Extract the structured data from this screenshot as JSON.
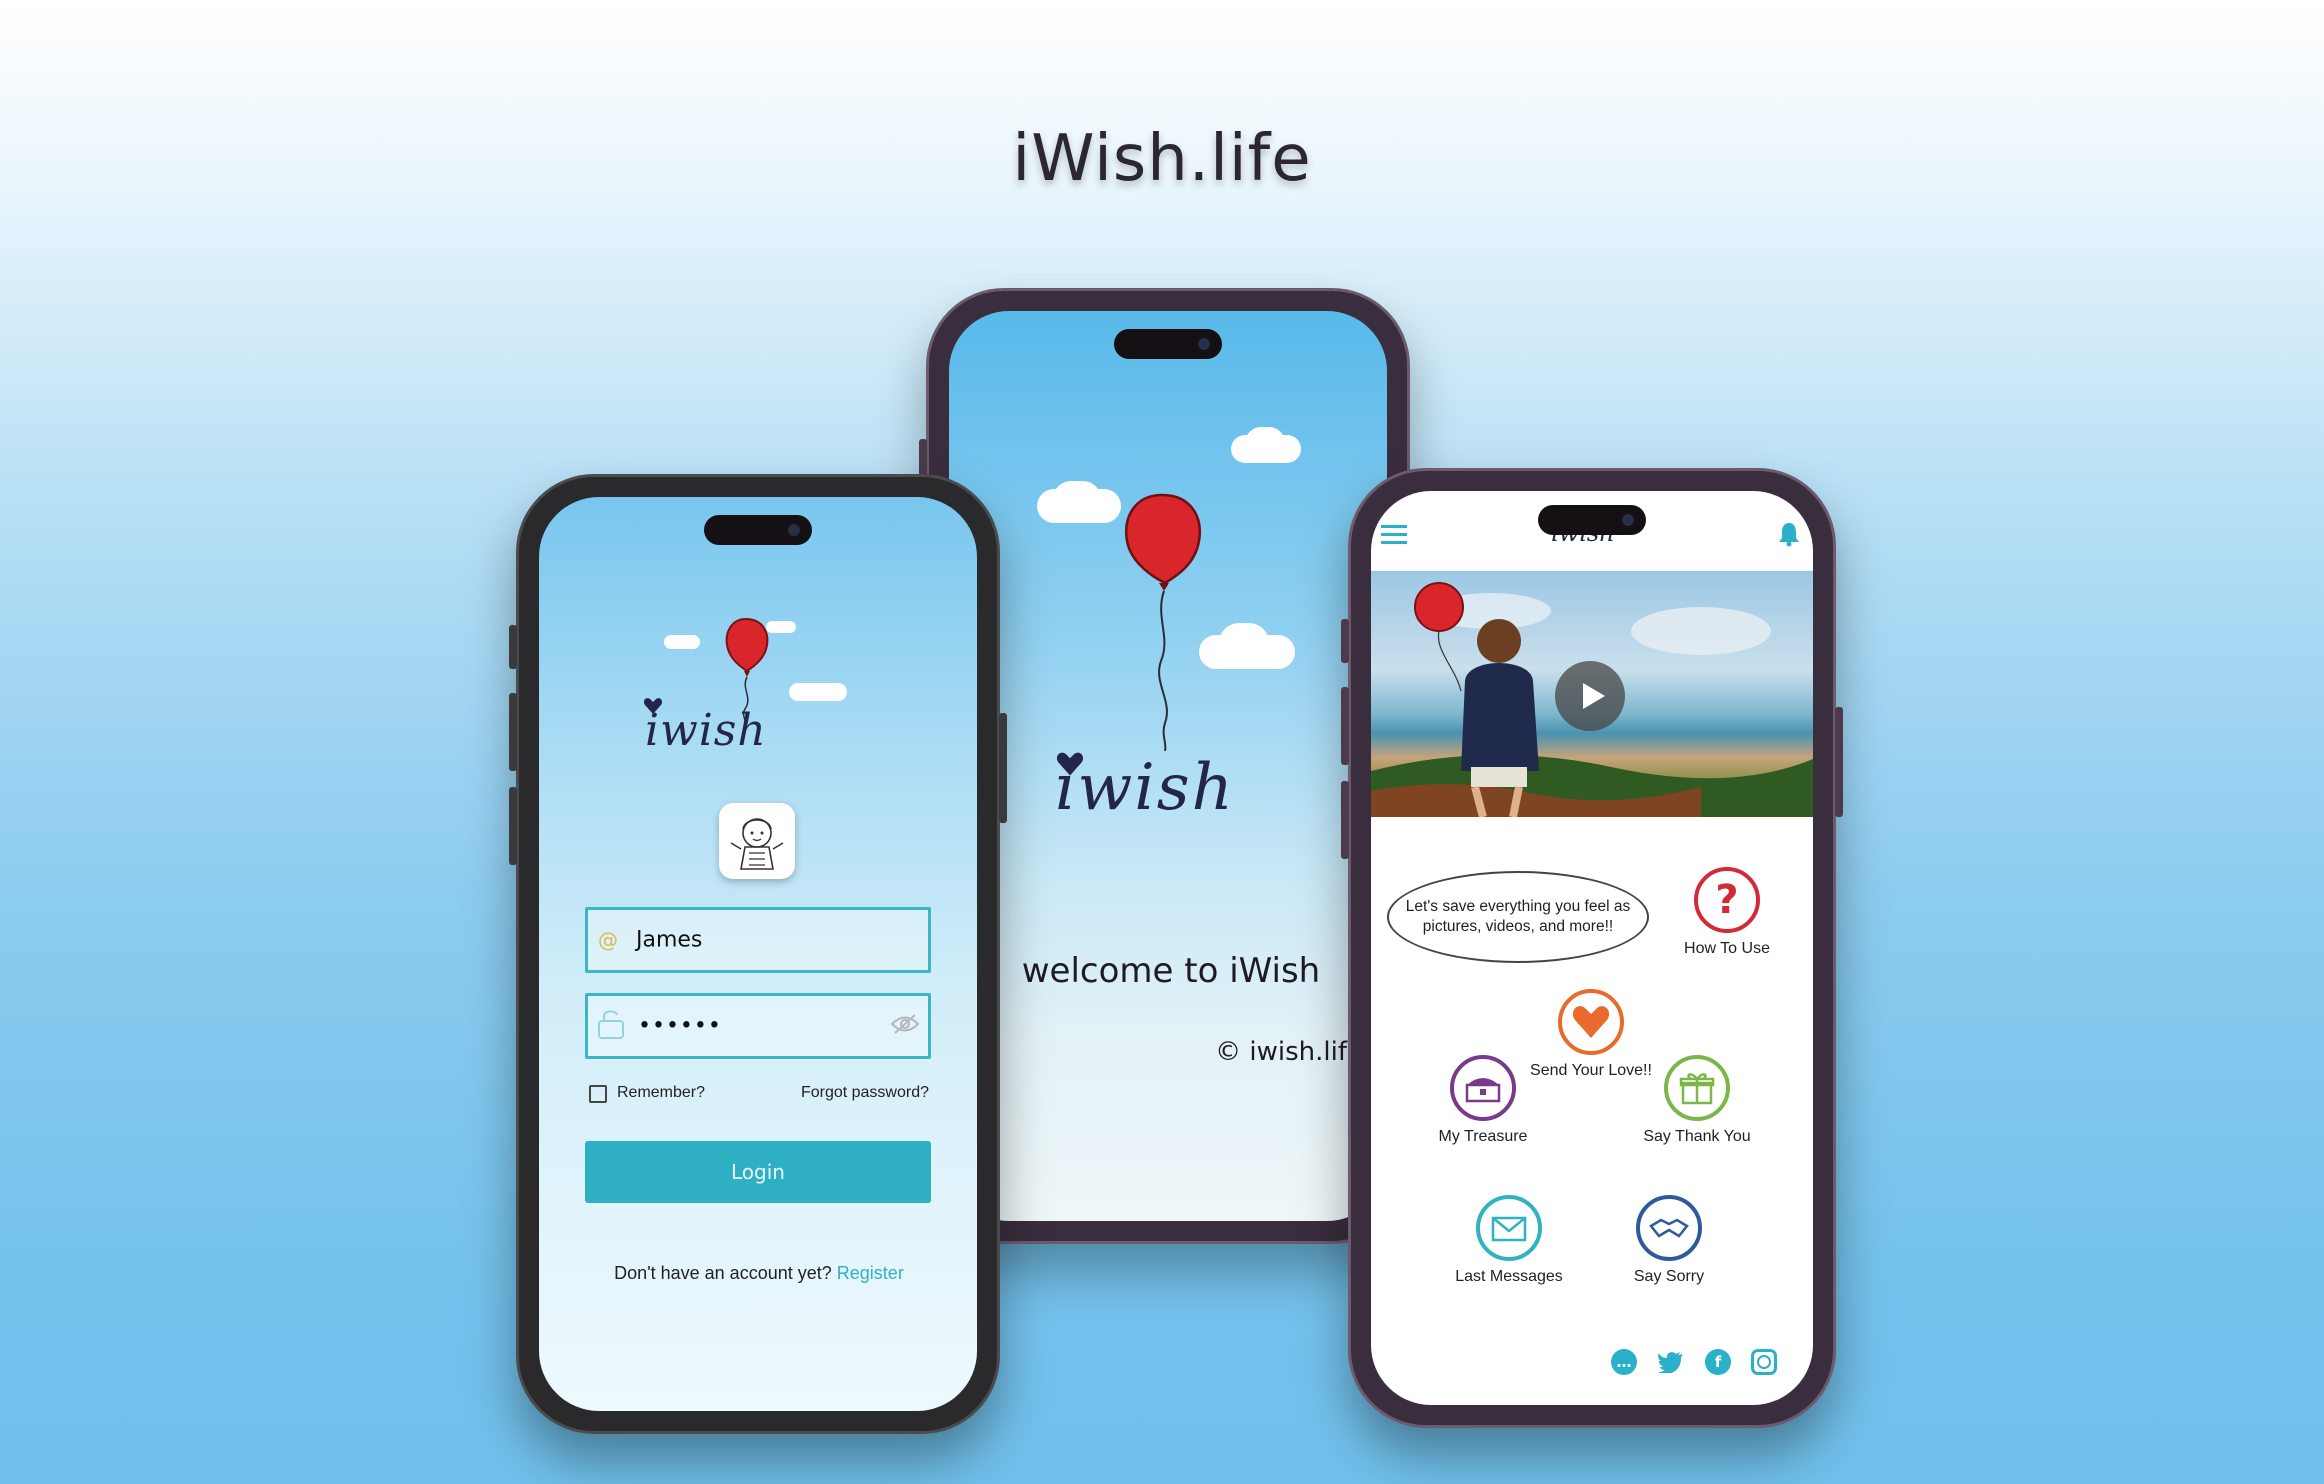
{
  "headline": "iWish.life",
  "login_screen": {
    "logo_text": "iwish",
    "username_value": "James",
    "password_value": "••••••",
    "remember_label": "Remember?",
    "forgot_label": "Forgot password?",
    "login_label": "Login",
    "signup_prompt": "Don't have an account yet?",
    "register_label": "Register"
  },
  "welcome_screen": {
    "logo_text": "iwish",
    "welcome_text": "welcome to iWish",
    "copyright_text": "© iwish.life"
  },
  "home_screen": {
    "header_logo": "iwish",
    "speech_bubble": "Let's save everything you feel as pictures, videos, and more!!",
    "menu": {
      "how_to_use": "How To Use",
      "send_love": "Send Your Love!!",
      "my_treasure": "My Treasure",
      "say_thank_you": "Say Thank You",
      "last_messages": "Last Messages",
      "say_sorry": "Say Sorry"
    }
  },
  "colors": {
    "accent_teal": "#2eb0c2",
    "balloon_red": "#d8262b",
    "ink_navy": "#23264a"
  }
}
